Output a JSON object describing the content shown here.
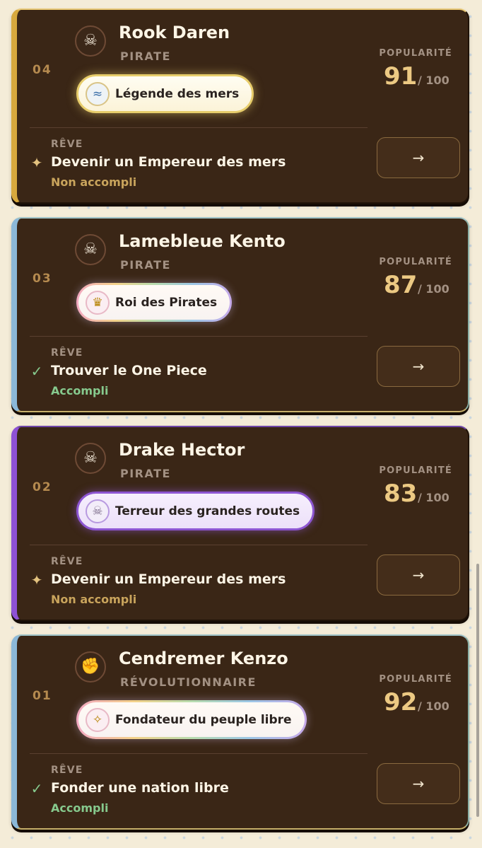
{
  "cards": [
    {
      "rank": "04",
      "avatar_icon": "pirate-flag-icon",
      "avatar_glyph": "☠",
      "name": "Rook Daren",
      "role": "PIRATE",
      "badge": {
        "icon": "wave-icon",
        "glyph": "≈",
        "label": "Légende des mers",
        "style": "gold"
      },
      "popularity_label": "POPULARITÉ",
      "popularity": "91",
      "popularity_max": "/ 100",
      "dream_label": "RÊVE",
      "dream": "Devenir un Empereur des mers",
      "dream_status": "Non accompli",
      "dream_done": false,
      "status_glyph": "✦",
      "action_glyph": "→",
      "accent_color": "#d7a93e"
    },
    {
      "rank": "03",
      "avatar_icon": "pirate-flag-icon",
      "avatar_glyph": "☠",
      "name": "Lamebleue Kento",
      "role": "PIRATE",
      "badge": {
        "icon": "crown-icon",
        "glyph": "♛",
        "label": "Roi des Pirates",
        "style": "rainbow"
      },
      "popularity_label": "POPULARITÉ",
      "popularity": "87",
      "popularity_max": "/ 100",
      "dream_label": "RÊVE",
      "dream": "Trouver le One Piece",
      "dream_status": "Accompli",
      "dream_done": true,
      "status_glyph": "✓",
      "action_glyph": "→",
      "accent_color": "#9fc7e8"
    },
    {
      "rank": "02",
      "avatar_icon": "pirate-flag-icon",
      "avatar_glyph": "☠",
      "name": "Drake Hector",
      "role": "PIRATE",
      "badge": {
        "icon": "skull-crossbones-icon",
        "glyph": "☠",
        "label": "Terreur des grandes routes",
        "style": "violet"
      },
      "popularity_label": "POPULARITÉ",
      "popularity": "83",
      "popularity_max": "/ 100",
      "dream_label": "RÊVE",
      "dream": "Devenir un Empereur des mers",
      "dream_status": "Non accompli",
      "dream_done": false,
      "status_glyph": "✦",
      "action_glyph": "→",
      "accent_color": "#8e51d6"
    },
    {
      "rank": "01",
      "avatar_icon": "raised-fist-icon",
      "avatar_glyph": "✊",
      "name": "Cendremer Kenzo",
      "role": "RÉVOLUTIONNAIRE",
      "badge": {
        "icon": "dove-icon",
        "glyph": "✧",
        "label": "Fondateur du peuple libre",
        "style": "rainbow"
      },
      "popularity_label": "POPULARITÉ",
      "popularity": "92",
      "popularity_max": "/ 100",
      "dream_label": "RÊVE",
      "dream": "Fonder une nation libre",
      "dream_status": "Accompli",
      "dream_done": true,
      "status_glyph": "✓",
      "action_glyph": "→",
      "accent_color": "#9fc7e8"
    }
  ]
}
